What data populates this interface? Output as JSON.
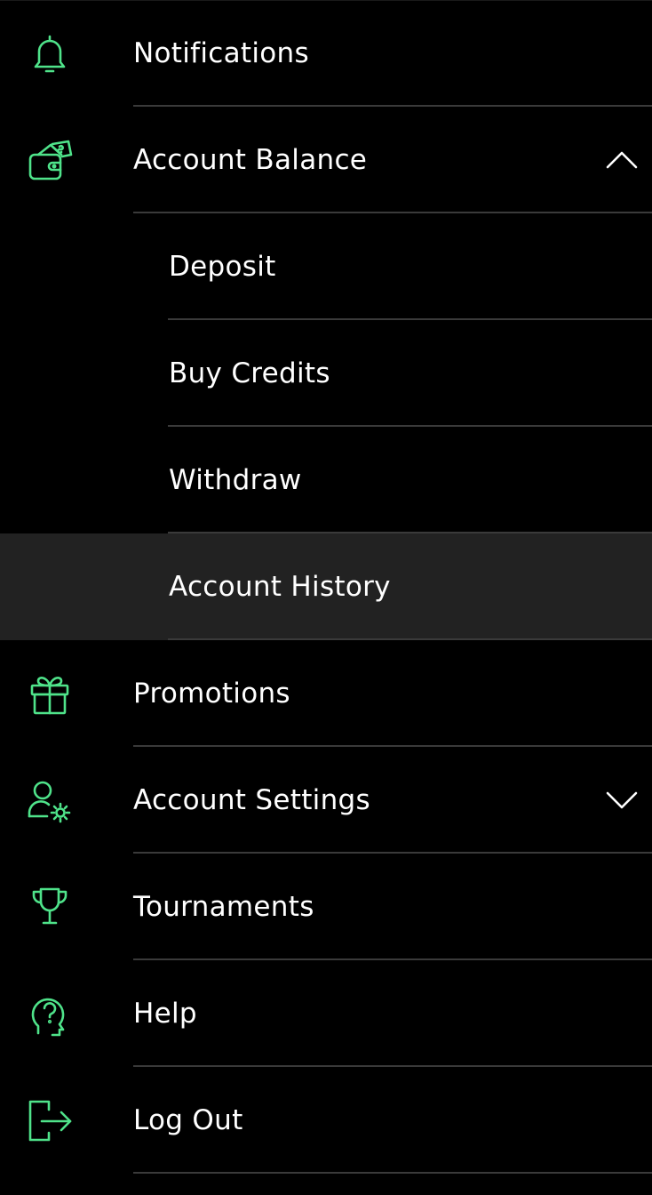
{
  "colors": {
    "background": "#000000",
    "accent": "#4fe38a",
    "text": "#ffffff",
    "divider": "#3a3a3a",
    "active_row": "#222222"
  },
  "menu": {
    "notifications": {
      "label": "Notifications",
      "icon": "bell-icon"
    },
    "account_balance": {
      "label": "Account Balance",
      "icon": "wallet-icon",
      "chevron": "chevron-up-icon",
      "expanded": true,
      "children": {
        "deposit": "Deposit",
        "buy_credits": "Buy Credits",
        "withdraw": "Withdraw",
        "account_history": "Account History"
      }
    },
    "promotions": {
      "label": "Promotions",
      "icon": "gift-icon"
    },
    "account_settings": {
      "label": "Account Settings",
      "icon": "user-settings-icon",
      "chevron": "chevron-down-icon",
      "expanded": false
    },
    "tournaments": {
      "label": "Tournaments",
      "icon": "trophy-icon"
    },
    "help": {
      "label": "Help",
      "icon": "help-head-icon"
    },
    "log_out": {
      "label": "Log Out",
      "icon": "logout-icon"
    }
  }
}
